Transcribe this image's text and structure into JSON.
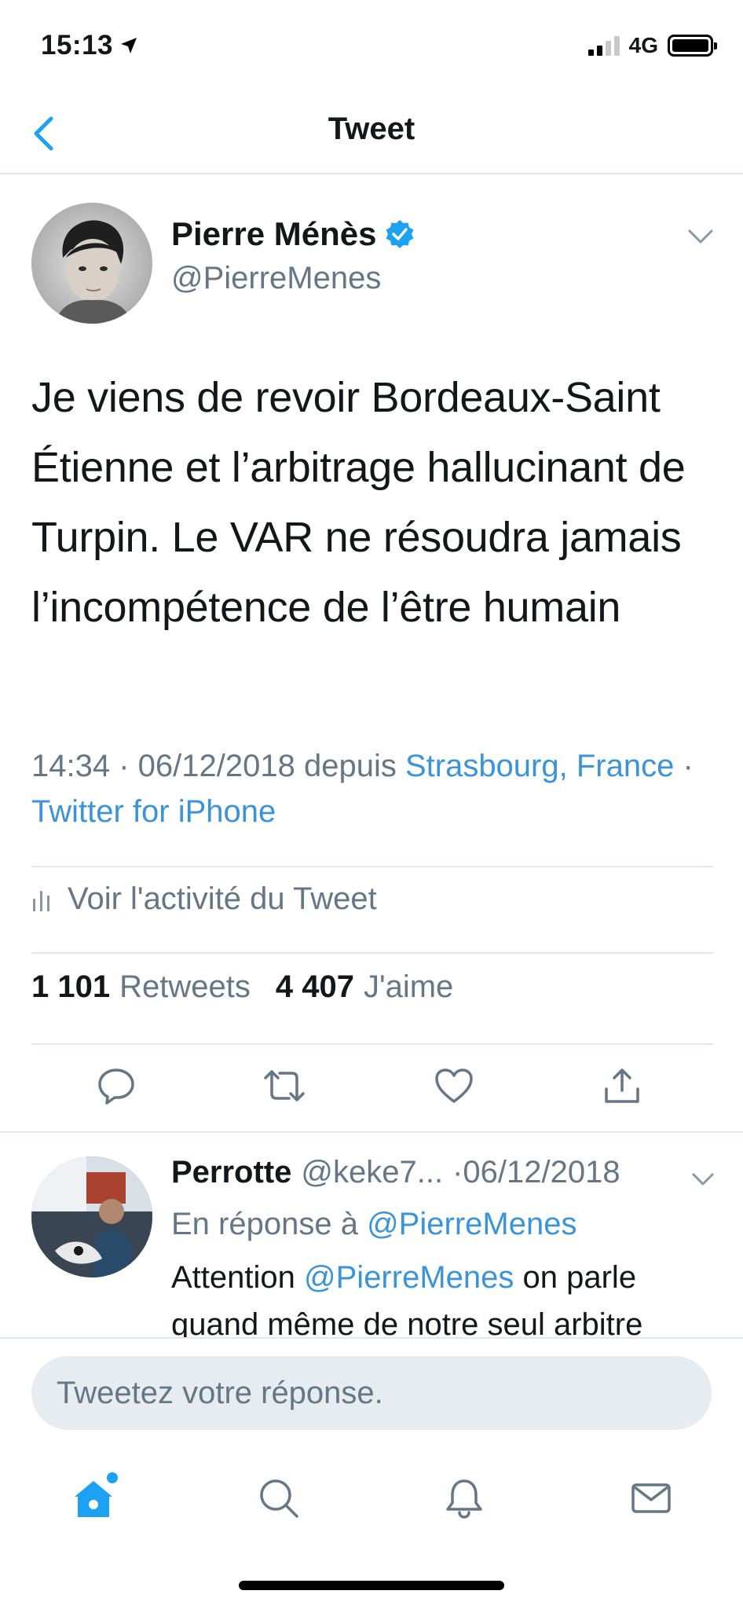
{
  "status_bar": {
    "time": "15:13",
    "network": "4G"
  },
  "nav": {
    "title": "Tweet"
  },
  "tweet": {
    "author_name": "Pierre Ménès",
    "author_handle": "@PierreMenes",
    "text": "Je viens de revoir Bordeaux-Saint Étienne et l’arbitrage hallucinant de Turpin. Le VAR ne résoudra jamais l’incompétence de l’être humain",
    "timestamp": "14:34 · 06/12/2018 depuis",
    "location": "Strasbourg, France",
    "separator": "·",
    "source": "Twitter for iPhone",
    "activity_label": "Voir l'activité du Tweet",
    "retweet_count": "1 101",
    "retweet_label": "Retweets",
    "like_count": "4 407",
    "like_label": "J'aime"
  },
  "reply": {
    "name": "Perrotte",
    "handle": "@keke7...",
    "date": "·06/12/2018",
    "reply_to_prefix": "En réponse à",
    "reply_to_handle": "@PierreMenes",
    "text_start": "Attention",
    "mention": "@PierreMenes",
    "text_end": "on parle quand même de notre seul arbitre"
  },
  "compose": {
    "placeholder": "Tweetez votre réponse."
  },
  "colors": {
    "accent": "#1da1f2",
    "link": "#3b94d9",
    "secondary_text": "#657786",
    "divider": "#e1e8ed"
  },
  "icons": {
    "location": "location-arrow-icon",
    "back": "chevron-left-icon",
    "verified": "verified-badge-icon",
    "caret": "chevron-down-icon",
    "activity": "bar-chart-icon",
    "reply": "reply-icon",
    "retweet": "retweet-icon",
    "like": "heart-icon",
    "share": "share-icon",
    "home": "home-icon",
    "search": "search-icon",
    "notifications": "bell-icon",
    "messages": "mail-icon"
  }
}
